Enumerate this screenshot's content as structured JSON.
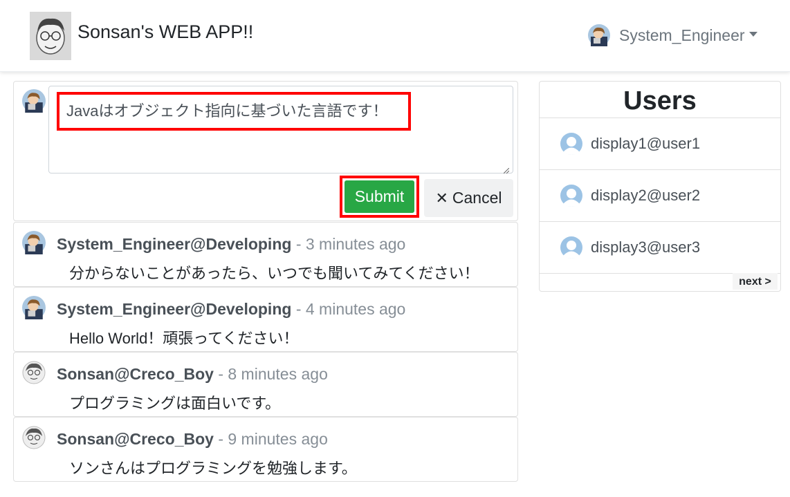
{
  "navbar": {
    "brand_title": "Sonsan's WEB APP!!",
    "user_name": "System_Engineer"
  },
  "post_form": {
    "input_value": "Javaはオブジェクト指向に基づいた言語です！",
    "submit_label": "Submit",
    "cancel_label": "Cancel",
    "cancel_icon": "✕"
  },
  "posts": [
    {
      "author": "System_Engineer@Developing",
      "time": "- 3 minutes ago",
      "body": "分からないことがあったら、いつでも聞いてみてください！"
    },
    {
      "author": "System_Engineer@Developing",
      "time": "- 4 minutes ago",
      "body": "Hello World！頑張ってください！"
    },
    {
      "author": "Sonsan@Creco_Boy",
      "time": "- 8 minutes ago",
      "body": "プログラミングは面白いです。"
    },
    {
      "author": "Sonsan@Creco_Boy",
      "time": "- 9 minutes ago",
      "body": "ソンさんはプログラミングを勉強します。"
    }
  ],
  "users_panel": {
    "title": "Users",
    "users": [
      "display1@user1",
      "display2@user2",
      "display3@user3"
    ],
    "next_label": "next >"
  },
  "colors": {
    "submit_green": "#28a745",
    "highlight_red": "#ff0000",
    "default_avatar_blue": "#9cc3e5"
  }
}
